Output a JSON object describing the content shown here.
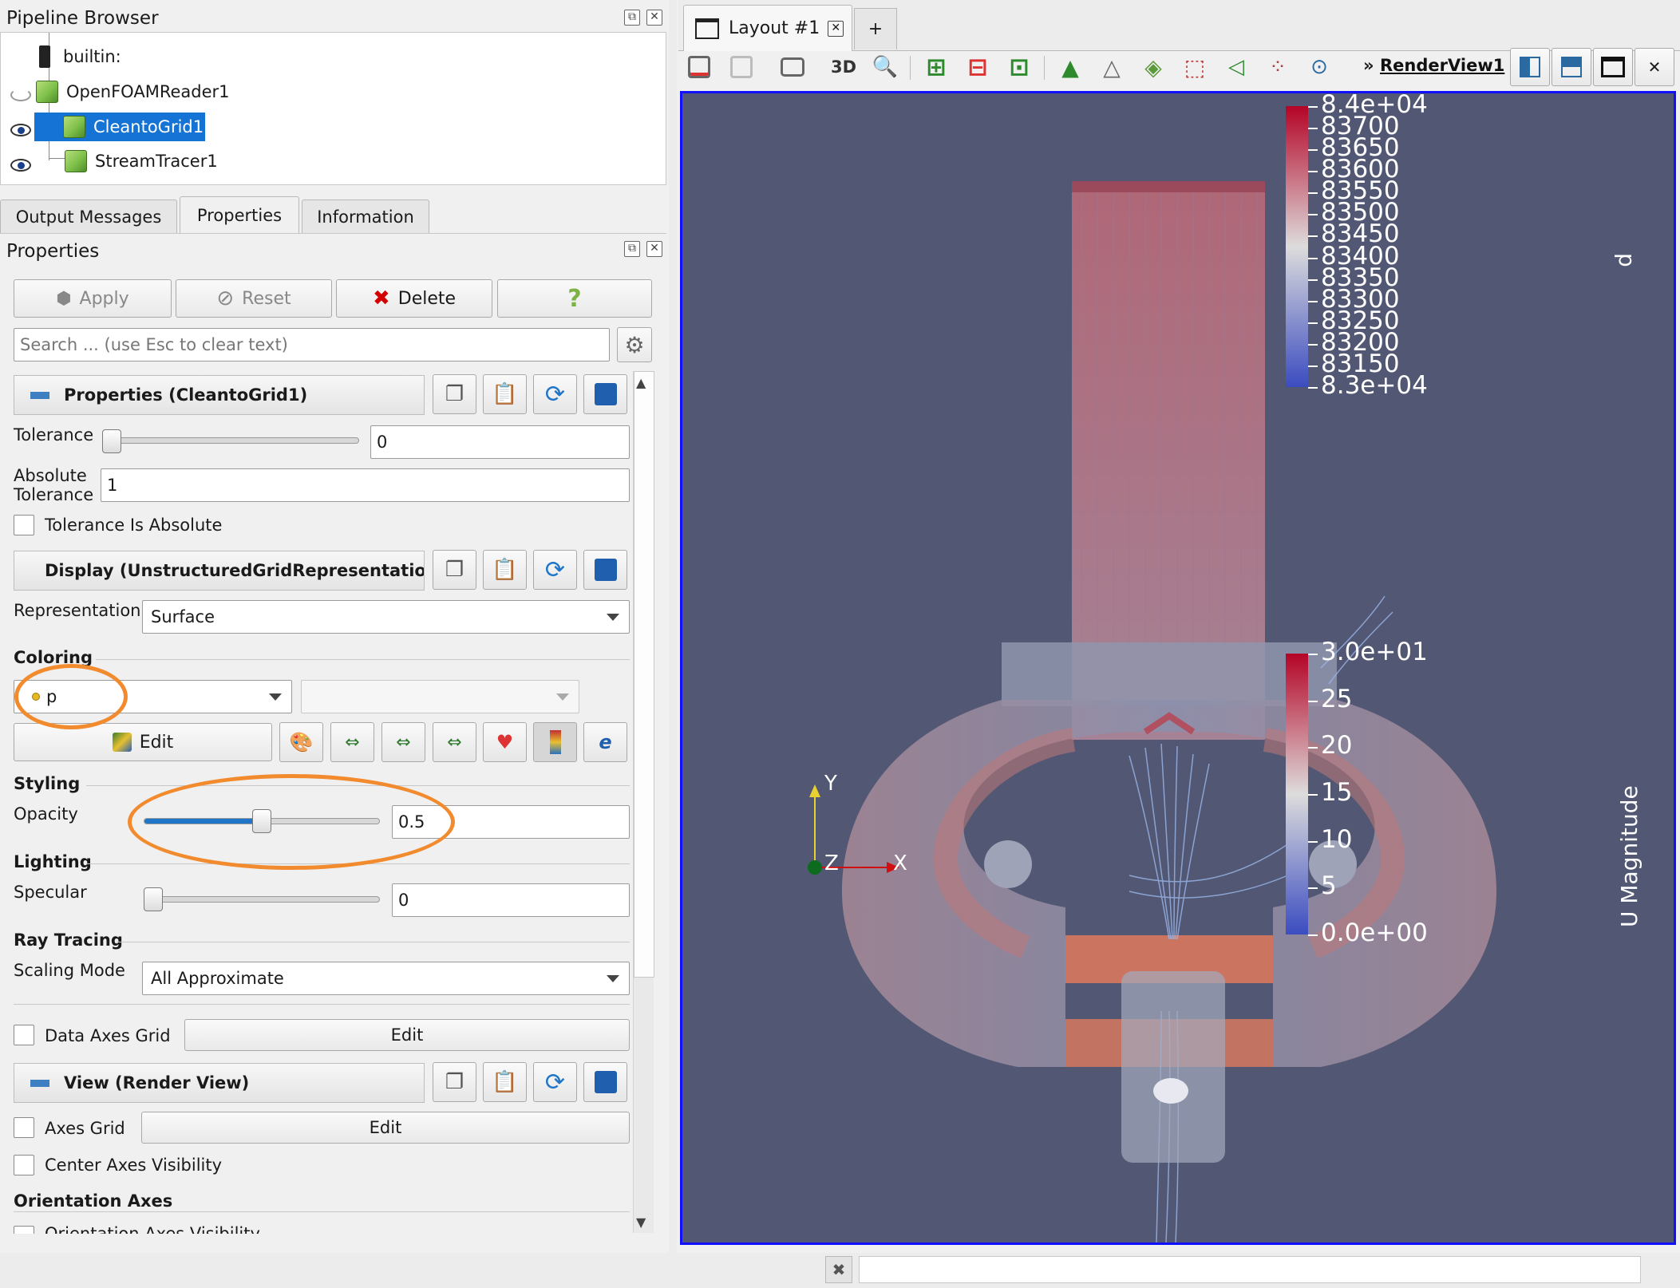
{
  "pipeline_browser": {
    "title": "Pipeline Browser",
    "items": [
      {
        "label": "builtin:"
      },
      {
        "label": "OpenFOAMReader1"
      },
      {
        "label": "CleantoGrid1"
      },
      {
        "label": "StreamTracer1"
      }
    ]
  },
  "tabs": [
    "Output Messages",
    "Properties",
    "Information"
  ],
  "properties_panel": {
    "title": "Properties",
    "buttons": {
      "apply": "Apply",
      "reset": "Reset",
      "delete": "Delete",
      "help": "?"
    },
    "search_placeholder": "Search ... (use Esc to clear text)",
    "section_properties": "Properties (CleantoGrid1)",
    "tolerance_label": "Tolerance",
    "tolerance_value": "0",
    "abs_tolerance_label_1": "Absolute",
    "abs_tolerance_label_2": "Tolerance",
    "abs_tolerance_value": "1",
    "tolerance_is_absolute": "Tolerance Is Absolute",
    "section_display": "Display (UnstructuredGridRepresentation",
    "representation_label": "Representation",
    "representation_value": "Surface",
    "coloring_label": "Coloring",
    "coloring_value": "p",
    "edit_label": "Edit",
    "styling_label": "Styling",
    "opacity_label": "Opacity",
    "opacity_value": "0.5",
    "opacity_fraction": 0.5,
    "lighting_label": "Lighting",
    "specular_label": "Specular",
    "specular_value": "0",
    "raytracing_label": "Ray Tracing",
    "scaling_mode_label": "Scaling Mode",
    "scaling_mode_value": "All Approximate",
    "data_axes_grid": "Data Axes Grid",
    "data_axes_edit": "Edit",
    "section_view": "View (Render View)",
    "axes_grid": "Axes Grid",
    "axes_grid_edit": "Edit",
    "center_axes_visibility": "Center Axes Visibility",
    "orientation_axes_label": "Orientation Axes",
    "orientation_axes_visibility": "Orientation Axes Visibility"
  },
  "layout": {
    "tab_label": "Layout #1",
    "add_tab": "+",
    "toolbar_3d": "3D",
    "render_view_label": "RenderView1",
    "render_view_prefix": "»"
  },
  "legend_p": {
    "title": "p",
    "ticks": [
      "8.4e+04",
      "83700",
      "83650",
      "83600",
      "83550",
      "83500",
      "83450",
      "83400",
      "83350",
      "83300",
      "83250",
      "83200",
      "83150",
      "8.3e+04"
    ]
  },
  "legend_u": {
    "title": "U Magnitude",
    "ticks": [
      "3.0e+01",
      "25",
      "20",
      "15",
      "10",
      "5",
      "0.0e+00"
    ]
  },
  "axes": {
    "y": "Y",
    "z": "Z",
    "x": "X"
  },
  "colors": {
    "selection": "#1473d4",
    "render_bg": "#525773",
    "accent_orange": "#f28a2e",
    "render_border": "#1010ff"
  }
}
